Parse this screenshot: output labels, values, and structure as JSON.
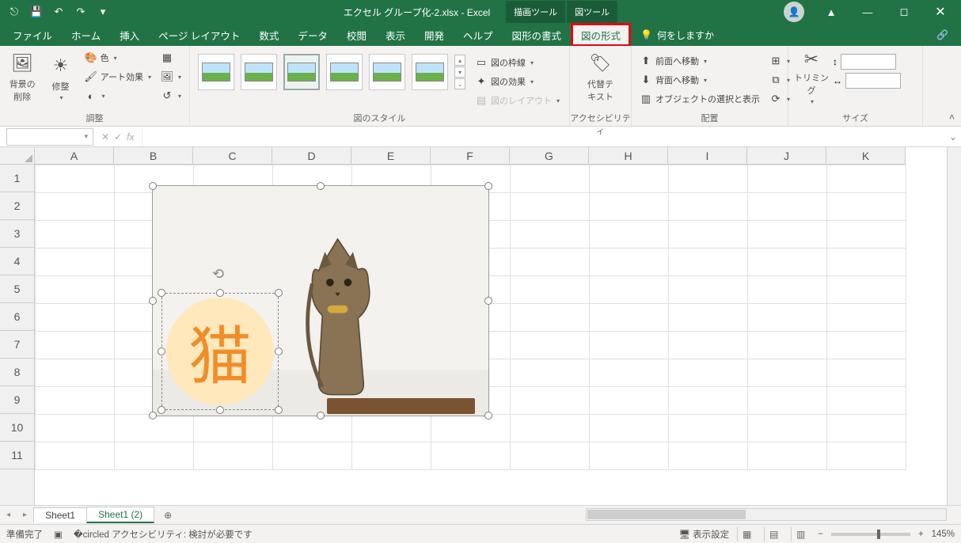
{
  "title": {
    "filename": "エクセル グループ化-2.xlsx",
    "app": "Excel"
  },
  "tool_context_tabs": [
    "描画ツール",
    "図ツール"
  ],
  "qat": {
    "autosave_off_icon": "⎚",
    "save": "💾",
    "undo": "↶",
    "redo": "↷",
    "more": "▾"
  },
  "tabs": [
    "ファイル",
    "ホーム",
    "挿入",
    "ページ レイアウト",
    "数式",
    "データ",
    "校閲",
    "表示",
    "開発",
    "ヘルプ",
    "図形の書式",
    "図の形式"
  ],
  "tell_me": "何をしますか",
  "ribbon": {
    "remove_bg": "背景の\n削除",
    "corrections": "修整",
    "color": "色",
    "artistic": "アート効果",
    "transparency_icon": "▦",
    "compress_icon": "▥",
    "change_pic_icon": "⍰",
    "reset_icon": "↺",
    "group_adjust": "調整",
    "group_styles": "図のスタイル",
    "border": "図の枠線",
    "effects": "図の効果",
    "layout": "図のレイアウト",
    "alt_text": "代替テ\nキスト",
    "group_access": "アクセシビリティ",
    "bring_fwd": "前面へ移動",
    "send_back": "背面へ移動",
    "selection_pane": "オブジェクトの選択と表示",
    "align_icon": "⊞",
    "group_icon": "⧉",
    "rotate_icon": "⟳",
    "group_arrange": "配置",
    "crop": "トリミング",
    "group_size": "サイズ"
  },
  "formula": {
    "namebox": "",
    "fx": "fx"
  },
  "columns": [
    "A",
    "B",
    "C",
    "D",
    "E",
    "F",
    "G",
    "H",
    "I",
    "J",
    "K"
  ],
  "rows": [
    "1",
    "2",
    "3",
    "4",
    "5",
    "6",
    "7",
    "8",
    "9",
    "10",
    "11"
  ],
  "shape_text": "猫",
  "sheet_tabs": [
    "Sheet1",
    "Sheet1 (2)"
  ],
  "status": {
    "ready": "準備完了",
    "macro_icon": "▦",
    "accessibility": "アクセシビリティ: 検討が必要です",
    "display_settings": "表示設定",
    "zoom": "145%"
  }
}
